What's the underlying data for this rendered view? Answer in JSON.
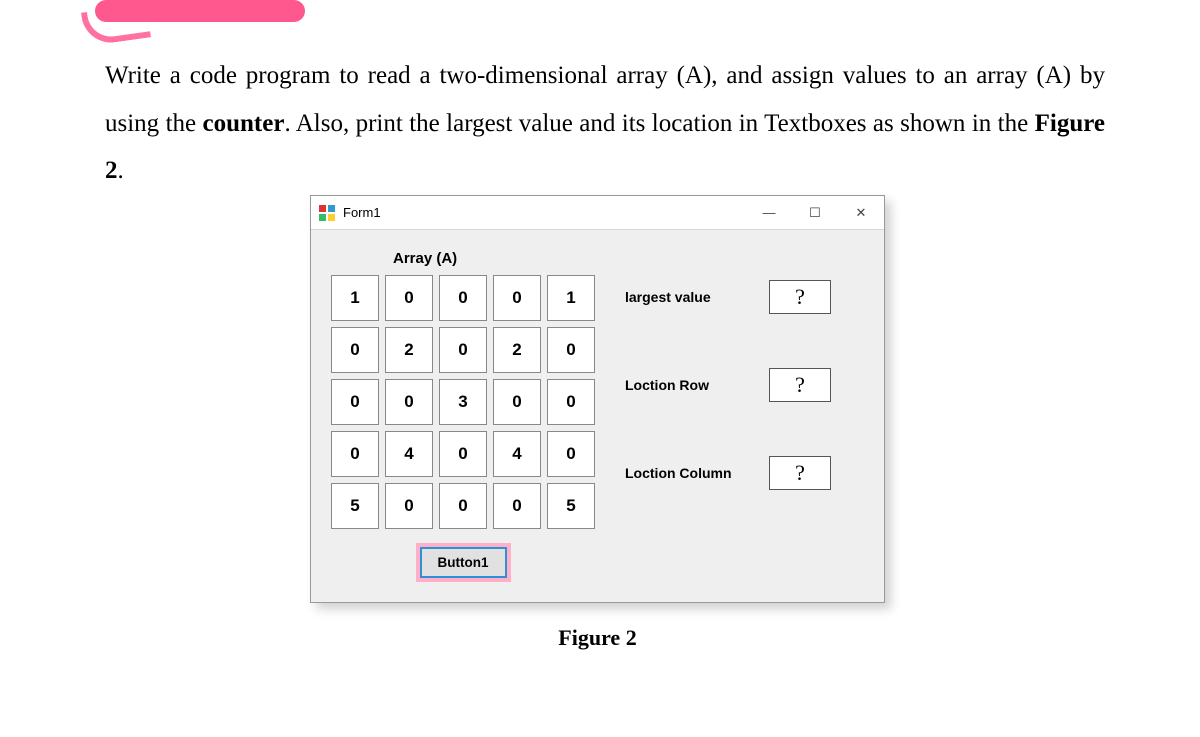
{
  "question": {
    "p1a": "Write a code program to read a two-dimensional array (A), and assign values to an array (A) by using the ",
    "p1b": "counter",
    "p1c": ". Also, print the largest value and its location in Textboxes as shown in the ",
    "p1d": "Figure 2",
    "p1e": "."
  },
  "window": {
    "title": "Form1",
    "minimize": "—",
    "maximize": "☐",
    "close": "✕"
  },
  "array_label": "Array (A)",
  "grid": {
    "r0": {
      "c0": "1",
      "c1": "0",
      "c2": "0",
      "c3": "0",
      "c4": "1"
    },
    "r1": {
      "c0": "0",
      "c1": "2",
      "c2": "0",
      "c3": "2",
      "c4": "0"
    },
    "r2": {
      "c0": "0",
      "c1": "0",
      "c2": "3",
      "c3": "0",
      "c4": "0"
    },
    "r3": {
      "c0": "0",
      "c1": "4",
      "c2": "0",
      "c3": "4",
      "c4": "0"
    },
    "r4": {
      "c0": "5",
      "c1": "0",
      "c2": "0",
      "c3": "0",
      "c4": "5"
    }
  },
  "button1": "Button1",
  "fields": {
    "largest_label": "largest value",
    "largest_value": "?",
    "row_label": "Loction Row",
    "row_value": "?",
    "col_label": "Loction Column",
    "col_value": "?"
  },
  "caption": "Figure 2"
}
